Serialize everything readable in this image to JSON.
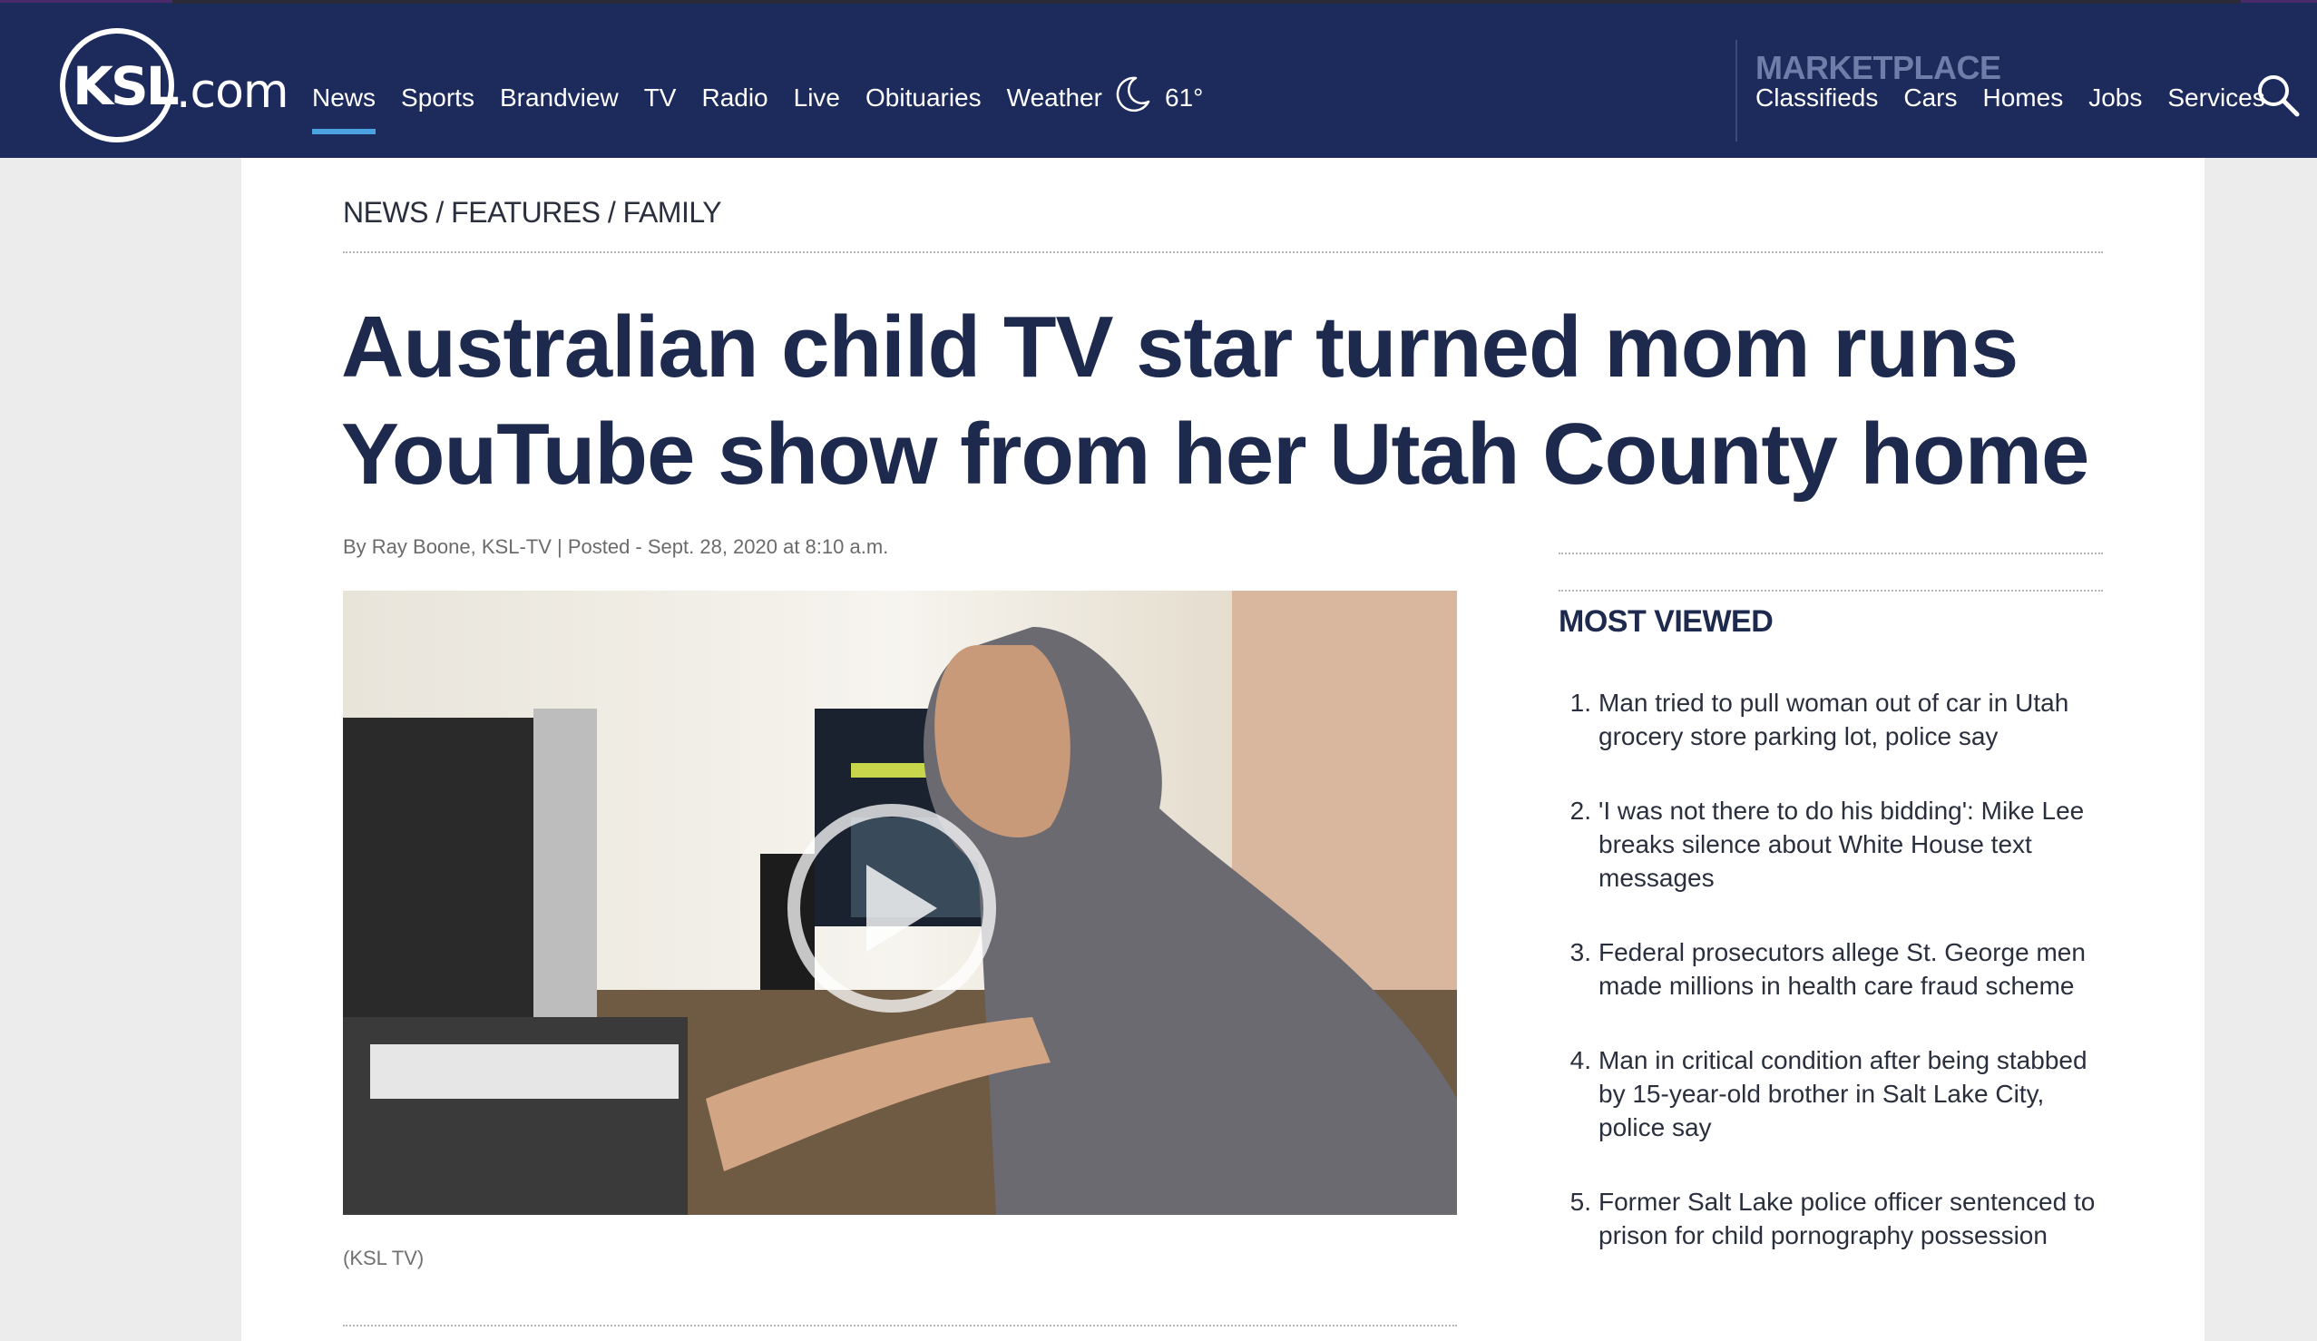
{
  "site": {
    "logo_text": "KSL",
    "logo_suffix": ".com"
  },
  "nav": {
    "items": [
      "News",
      "Sports",
      "Brandview",
      "TV",
      "Radio",
      "Live",
      "Obituaries",
      "Weather"
    ],
    "active": "News"
  },
  "weather": {
    "icon": "moon-icon",
    "temperature": "61°"
  },
  "marketplace": {
    "title": "MARKETPLACE",
    "items": [
      "Classifieds",
      "Cars",
      "Homes",
      "Jobs",
      "Services"
    ]
  },
  "breadcrumb": "NEWS / FEATURES / FAMILY",
  "article": {
    "headline_line1": "Australian child TV star turned mom runs",
    "headline_line2": "YouTube show from her Utah County home",
    "byline": "By Ray Boone, KSL-TV | Posted - Sept. 28, 2020 at 8:10 a.m.",
    "caption": "(KSL TV)"
  },
  "sidebar": {
    "title": "MOST VIEWED",
    "items": [
      {
        "num": "1.",
        "text": "Man tried to pull woman out of car in Utah grocery store parking lot, police say"
      },
      {
        "num": "2.",
        "text": "'I was not there to do his bidding': Mike Lee breaks silence about White House text messages"
      },
      {
        "num": "3.",
        "text": "Federal prosecutors allege St. George men made millions in health care fraud scheme"
      },
      {
        "num": "4.",
        "text": "Man in critical condition after being stabbed by 15-year-old brother in Salt Lake City, police say"
      },
      {
        "num": "5.",
        "text": "Former Salt Lake police officer sentenced to prison for child pornography possession"
      }
    ]
  },
  "colors": {
    "header_bg": "#1d2a5c",
    "active_underline": "#4aa3e0",
    "headline": "#1d2a4e",
    "marketplace_title": "#6d7ea8"
  }
}
